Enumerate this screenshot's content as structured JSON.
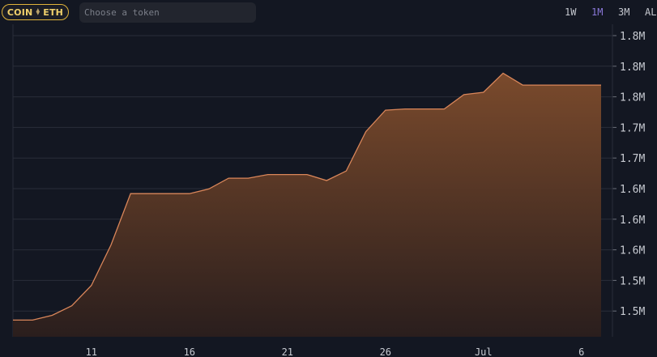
{
  "toolbar": {
    "pair_left": "COIN",
    "pair_right": "ETH",
    "search_placeholder": "Choose a token",
    "ranges": [
      "1W",
      "1M",
      "3M",
      "AL"
    ],
    "active_range": "1M"
  },
  "colors": {
    "background": "#131722",
    "line": "#d9865a",
    "fill_top": "#7a4a2c",
    "fill_bottom": "#2a1e1d",
    "grid": "#2a2e39",
    "active_tab": "#8a78d9",
    "pair_border": "#e0b33a"
  },
  "chart_data": {
    "type": "area",
    "x": [
      "Jun 7",
      "Jun 8",
      "Jun 9",
      "Jun 10",
      "Jun 11",
      "Jun 12",
      "Jun 13",
      "Jun 14",
      "Jun 15",
      "Jun 16",
      "Jun 17",
      "Jun 18",
      "Jun 19",
      "Jun 20",
      "Jun 21",
      "Jun 22",
      "Jun 23",
      "Jun 24",
      "Jun 25",
      "Jun 26",
      "Jun 27",
      "Jun 28",
      "Jun 29",
      "Jun 30",
      "Jul 1",
      "Jul 2",
      "Jul 3",
      "Jul 4",
      "Jul 5",
      "Jul 6",
      "Jul 7"
    ],
    "values": [
      1474000,
      1474000,
      1478000,
      1486000,
      1503000,
      1537000,
      1580000,
      1580000,
      1580000,
      1580000,
      1584000,
      1593000,
      1593000,
      1596000,
      1596000,
      1596000,
      1591000,
      1599000,
      1632000,
      1650000,
      1651000,
      1651000,
      1651000,
      1663000,
      1665000,
      1681000,
      1671000,
      1671000,
      1671000,
      1671000,
      1671000
    ],
    "x_ticks": [
      "11",
      "16",
      "21",
      "26",
      "Jul",
      "6"
    ],
    "y_ticks": [
      "1.5M",
      "1.5M",
      "1.6M",
      "1.6M",
      "1.6M",
      "1.7M",
      "1.7M",
      "1.8M",
      "1.8M",
      "1.8M"
    ],
    "ylim": [
      1460000,
      1722000
    ],
    "grid": true,
    "title": "",
    "xlabel": "",
    "ylabel": ""
  }
}
